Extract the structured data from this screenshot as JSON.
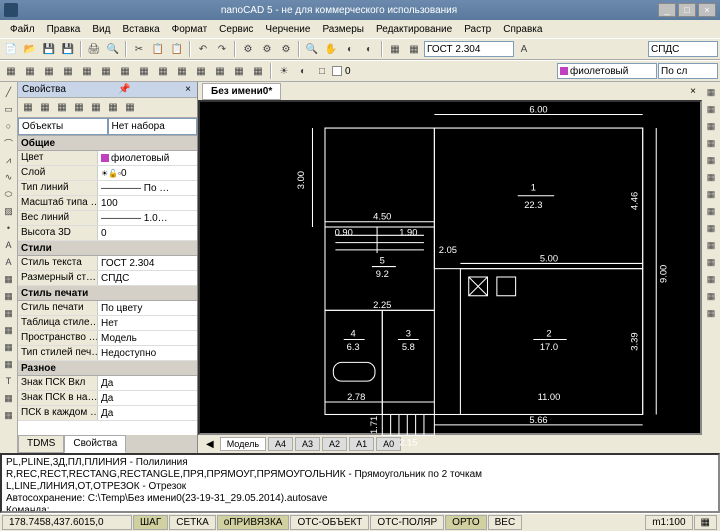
{
  "title": "nanoCAD 5 - не для коммерческого использования",
  "menu": [
    "Файл",
    "Правка",
    "Вид",
    "Вставка",
    "Формат",
    "Сервис",
    "Черчение",
    "Размеры",
    "Редактирование",
    "Растр",
    "Справка"
  ],
  "toolbar_combos": {
    "font": "ГОСТ 2.304",
    "dimstyle": "СПДС"
  },
  "layer_combo": "фиолетовый",
  "layer_combo2": "По сл",
  "props": {
    "panel_title": "Свойства",
    "sel_label": "Объекты",
    "sel_value": "Нет набора",
    "tabs": [
      "TDMS",
      "Свойства"
    ],
    "groups": [
      {
        "title": "Общие",
        "rows": [
          {
            "label": "Цвет",
            "value": "фиолетовый",
            "swatch": "violet"
          },
          {
            "label": "Слой",
            "value": "0",
            "icons": true
          },
          {
            "label": "Тип линий",
            "value": "———— По …"
          },
          {
            "label": "Масштаб типа …",
            "value": "100"
          },
          {
            "label": "Вес линий",
            "value": "———— 1.0…"
          },
          {
            "label": "Высота 3D",
            "value": "0"
          }
        ]
      },
      {
        "title": "Стили",
        "rows": [
          {
            "label": "Стиль текста",
            "value": "ГОСТ 2.304"
          },
          {
            "label": "Размерный ст…",
            "value": "СПДС"
          }
        ]
      },
      {
        "title": "Стиль печати",
        "rows": [
          {
            "label": "Стиль печати",
            "value": "По цвету"
          },
          {
            "label": "Таблица стиле…",
            "value": "Нет"
          },
          {
            "label": "Пространство …",
            "value": "Модель"
          },
          {
            "label": "Тип стилей печ…",
            "value": "Недоступно"
          }
        ]
      },
      {
        "title": "Разное",
        "rows": [
          {
            "label": "Знак ПСК Вкл",
            "value": "Да"
          },
          {
            "label": "Знак ПСК в на…",
            "value": "Да"
          },
          {
            "label": "ПСК в каждом …",
            "value": "Да"
          }
        ]
      }
    ]
  },
  "doc_tab": "Без имени0*",
  "model_tabs": [
    "Модель",
    "А4",
    "А3",
    "А2",
    "А1",
    "А0"
  ],
  "chart_data": {
    "type": "floorplan",
    "rooms": [
      {
        "id": "1",
        "area": "22.3",
        "dims": {
          "w": "6.00",
          "h": "4.46"
        }
      },
      {
        "id": "2",
        "area": "17.0",
        "dims": {
          "w": "5.00",
          "h": "3.39"
        }
      },
      {
        "id": "3",
        "area": "5.8"
      },
      {
        "id": "4",
        "area": "6.3"
      },
      {
        "id": "5",
        "area": "9.2"
      }
    ],
    "dimensions_outer": {
      "top": "6.00",
      "right": "9.00",
      "bottom_left": "2.78",
      "bottom_right": "11.00",
      "bottom_porch": "2.15",
      "left_porch": "1.71"
    },
    "dimensions_inner": [
      "3.00",
      "4.50",
      "0.90",
      "1.90",
      "2.05",
      "2.25",
      "5.00",
      "5.66",
      "4.46",
      "3.39"
    ]
  },
  "cmd": {
    "lines": [
      "PL,PLINE,3Д,ПЛ,ПЛИНИЯ - Полилиния",
      "R,REC,RECT,RECTANG,RECTANGLE,ПРЯ,ПРЯМОУГ,ПРЯМОУГОЛЬНИК - Прямоугольник по 2 точкам",
      "L,LINE,ЛИНИЯ,ОТ,ОТРЕЗОК - Отрезок",
      "Автосохранение: C:\\Temp\\Без имени0(23-19-31_29.05.2014).autosave"
    ],
    "prompt": "Команда:"
  },
  "status": {
    "coords": "178.7458,437.6015,0",
    "toggles": [
      "ШАГ",
      "СЕТКА",
      "оПРИВЯЗКА",
      "ОТС-ОБЪЕКТ",
      "ОТС-ПОЛЯР",
      "ОРТО",
      "ВЕС"
    ],
    "scale": "m1:100"
  }
}
